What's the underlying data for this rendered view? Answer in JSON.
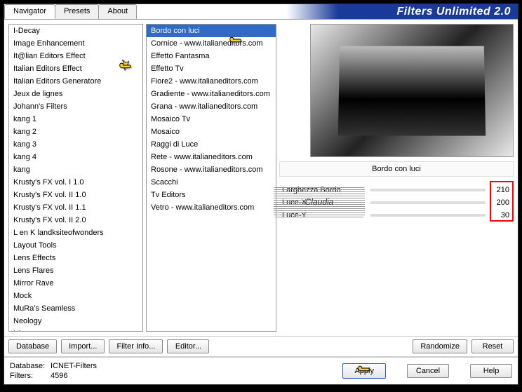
{
  "app": {
    "title": "Filters Unlimited 2.0"
  },
  "tabs": {
    "navigator": "Navigator",
    "presets": "Presets",
    "about": "About"
  },
  "left_list": [
    "I-Decay",
    "Image Enhancement",
    "It@lian Editors Effect",
    "Italian Editors Effect",
    "Italian Editors Generatore",
    "Jeux de lignes",
    "Johann's Filters",
    "kang 1",
    "kang 2",
    "kang 3",
    "kang 4",
    "kang",
    "Krusty's FX vol. I 1.0",
    "Krusty's FX vol. II 1.0",
    "Krusty's FX vol. II 1.1",
    "Krusty's FX vol. II 2.0",
    "L en K landksiteofwonders",
    "Layout Tools",
    "Lens Effects",
    "Lens Flares",
    "Mirror Rave",
    "Mock",
    "MuRa's Seamless",
    "Neology",
    "Nirvana"
  ],
  "mid_list": [
    "Bordo con luci",
    "Cornice - www.italianeditors.com",
    "Effetto Fantasma",
    "Effetto Tv",
    "Fiore2 - www.italianeditors.com",
    "Gradiente - www.italianeditors.com",
    "Grana - www.italianeditors.com",
    "Mosaico Tv",
    "Mosaico",
    "Raggi di Luce",
    "Rete - www.italianeditors.com",
    "Rosone - www.italianeditors.com",
    "Scacchi",
    "Tv Editors",
    "Vetro - www.italianeditors.com"
  ],
  "effect": {
    "name": "Bordo con luci"
  },
  "params": [
    {
      "name": "Larghezza Bordo",
      "value": 210
    },
    {
      "name": "Luce-X",
      "value": 200
    },
    {
      "name": "Luce-Y",
      "value": 30
    }
  ],
  "buttons": {
    "database": "Database",
    "import": "Import...",
    "filter_info": "Filter Info...",
    "editor": "Editor...",
    "randomize": "Randomize",
    "reset": "Reset",
    "apply": "Apply",
    "cancel": "Cancel",
    "help": "Help"
  },
  "status": {
    "db_label": "Database:",
    "db_value": "ICNET-Filters",
    "filters_label": "Filters:",
    "filters_value": "4596"
  },
  "watermark": "Claudia"
}
